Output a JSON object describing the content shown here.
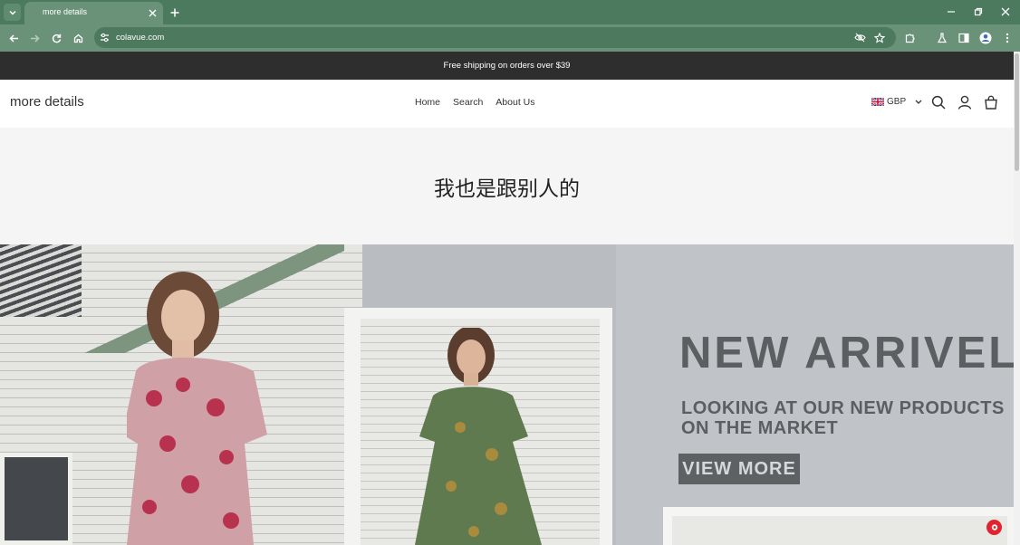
{
  "browser": {
    "tab_title": "more details",
    "url": "colavue.com"
  },
  "announcement": "Free shipping on orders over $39",
  "header": {
    "logo": "more details",
    "nav": [
      "Home",
      "Search",
      "About Us"
    ],
    "currency": "GBP"
  },
  "page_title": "我也是跟别人的",
  "hero": {
    "headline": "NEW ARRIVEL",
    "subhead": "LOOKING AT OUR NEW PRODUCTS\nON THE MARKET",
    "button": "VIEW MORE"
  },
  "colors": {
    "chrome": "#4c7a5e",
    "toolbar": "#6a9278",
    "announcement_bg": "#2e2e2e",
    "chat_bubble": "#e0232f"
  },
  "icons": {
    "tab_search": "chevron-down-icon",
    "back": "arrow-left-icon",
    "forward": "arrow-right-icon",
    "reload": "reload-icon",
    "home": "home-icon",
    "site_info": "tune-icon",
    "tracking": "eye-off-icon",
    "bookmark": "star-icon",
    "extensions": "puzzle-icon",
    "labs": "flask-icon",
    "side_panel": "side-panel-icon",
    "profile": "profile-icon",
    "menu": "kebab-menu-icon",
    "search": "search-icon",
    "account": "user-icon",
    "cart": "bag-icon"
  }
}
